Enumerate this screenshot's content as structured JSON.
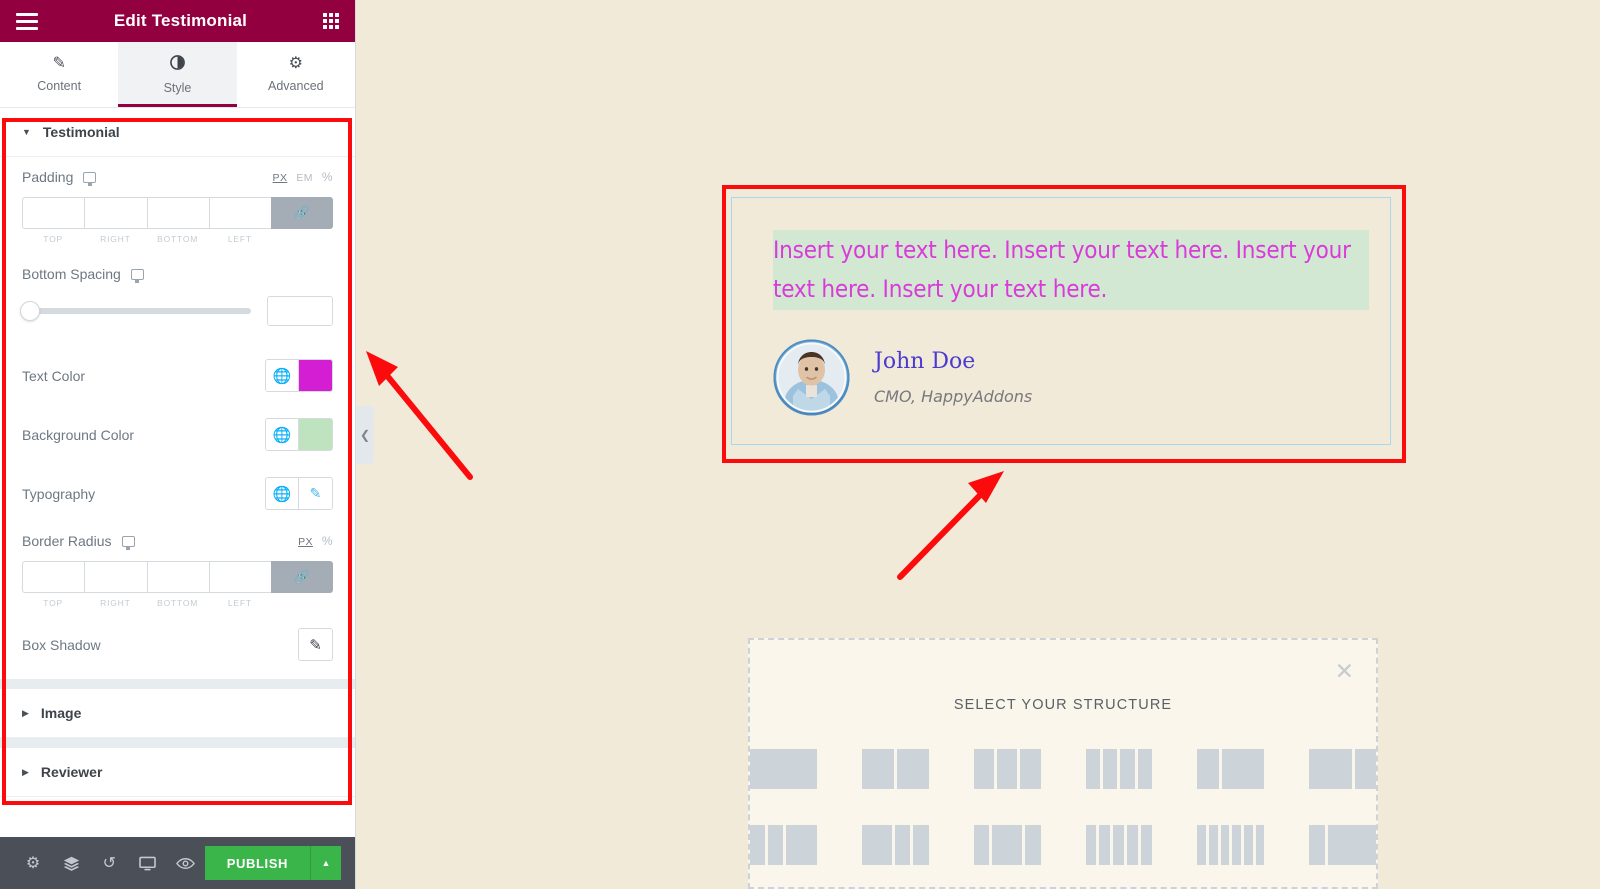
{
  "panel": {
    "header": {
      "title": "Edit Testimonial",
      "menu_icon": "hamburger-icon",
      "widgets_icon": "grid-icon"
    },
    "tabs": [
      {
        "label": "Content",
        "icon": "pencil-icon",
        "active": false
      },
      {
        "label": "Style",
        "icon": "contrast-icon",
        "active": true
      },
      {
        "label": "Advanced",
        "icon": "gear-icon",
        "active": false
      }
    ],
    "sections": [
      {
        "title": "Testimonial",
        "expanded": true
      },
      {
        "title": "Image",
        "expanded": false
      },
      {
        "title": "Reviewer",
        "expanded": false
      }
    ],
    "controls": {
      "padding": {
        "label": "Padding",
        "responsive_icon": "desktop-icon",
        "units": [
          "PX",
          "EM",
          "%"
        ],
        "active_unit": "PX",
        "values": [
          "",
          "",
          "",
          ""
        ],
        "side_labels": [
          "TOP",
          "RIGHT",
          "BOTTOM",
          "LEFT"
        ],
        "link_icon": "link-icon",
        "linked": true
      },
      "bottom_spacing": {
        "label": "Bottom Spacing",
        "responsive_icon": "desktop-icon",
        "value": "",
        "slider_percent": 0
      },
      "text_color": {
        "label": "Text Color",
        "globe_icon": "globe-icon",
        "color": "#d41ed4"
      },
      "background_color": {
        "label": "Background Color",
        "globe_icon": "globe-icon",
        "color": "#bfe2bf"
      },
      "typography": {
        "label": "Typography",
        "globe_icon": "globe-icon",
        "edit_icon": "pencil-icon",
        "edit_color": "#4bb4e6"
      },
      "border_radius": {
        "label": "Border Radius",
        "responsive_icon": "desktop-icon",
        "units": [
          "PX",
          "%"
        ],
        "active_unit": "PX",
        "values": [
          "",
          "",
          "",
          ""
        ],
        "side_labels": [
          "TOP",
          "RIGHT",
          "BOTTOM",
          "LEFT"
        ],
        "link_icon": "link-icon",
        "linked": true
      },
      "box_shadow": {
        "label": "Box Shadow",
        "edit_icon": "pencil-icon"
      }
    },
    "footer": {
      "icons": [
        "gear-icon",
        "layers-icon",
        "history-icon",
        "responsive-icon",
        "preview-eye-icon"
      ],
      "publish_label": "PUBLISH",
      "publish_color": "#39b54a",
      "publish_arrow_icon": "chevron-up-icon"
    },
    "collapse_handle_icon": "chevron-left-icon"
  },
  "canvas": {
    "background_color": "#f2ead9",
    "testimonial": {
      "quote": "Insert your text here. Insert your text here. Insert your text here. Insert your text here.",
      "quote_text_color": "#d93bd9",
      "quote_background_color": "#d3e8d3",
      "reviewer_name": "John Doe",
      "reviewer_name_color": "#4b3bd1",
      "reviewer_role": "CMO, HappyAddons",
      "reviewer_role_color": "#77797c",
      "avatar_alt": "reviewer-avatar",
      "selection_outline_color": "#a8d8ef"
    },
    "structure_picker": {
      "title": "SELECT YOUR STRUCTURE",
      "close_icon": "close-icon",
      "rows": [
        [
          [
            1
          ],
          [
            1,
            1
          ],
          [
            1,
            1,
            1
          ],
          [
            1,
            1,
            1,
            1
          ],
          [
            1,
            2
          ],
          [
            2,
            1
          ]
        ],
        [
          [
            1,
            1,
            2
          ],
          [
            2,
            1,
            1
          ],
          [
            1,
            2,
            1
          ],
          [
            1,
            1,
            1,
            1,
            1
          ],
          [
            1,
            1,
            1,
            1,
            1,
            1
          ],
          [
            1,
            3
          ]
        ]
      ]
    }
  },
  "annotations": {
    "color": "#fb0b0b",
    "boxes": [
      {
        "name": "panel-highlight"
      },
      {
        "name": "widget-highlight"
      }
    ],
    "arrows": [
      {
        "name": "arrow-to-panel"
      },
      {
        "name": "arrow-to-widget"
      }
    ]
  }
}
